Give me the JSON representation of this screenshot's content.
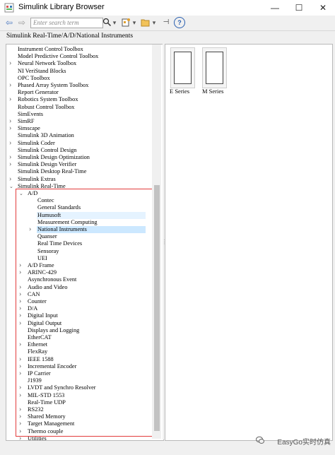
{
  "window": {
    "title": "Simulink Library Browser",
    "minimize_glyph": "—",
    "maximize_glyph": "☐",
    "close_glyph": "✕"
  },
  "toolbar": {
    "search_placeholder": "Enter search term",
    "back_glyph": "⇦",
    "forward_glyph": "⇨",
    "dropdown_glyph": "▾",
    "pin_glyph": "⊣",
    "help_glyph": "?"
  },
  "path": "Simulink Real-Time/A/D/National Instruments",
  "tree": [
    {
      "label": "Instrument Control Toolbox",
      "indent": 0,
      "arrow": ""
    },
    {
      "label": "Model Predictive Control Toolbox",
      "indent": 0,
      "arrow": ""
    },
    {
      "label": "Neural Network Toolbox",
      "indent": 0,
      "arrow": ">"
    },
    {
      "label": "NI VeriStand Blocks",
      "indent": 0,
      "arrow": ""
    },
    {
      "label": "OPC Toolbox",
      "indent": 0,
      "arrow": ""
    },
    {
      "label": "Phased Array System Toolbox",
      "indent": 0,
      "arrow": ">"
    },
    {
      "label": "Report Generator",
      "indent": 0,
      "arrow": ""
    },
    {
      "label": "Robotics System Toolbox",
      "indent": 0,
      "arrow": ">"
    },
    {
      "label": "Robust Control Toolbox",
      "indent": 0,
      "arrow": ""
    },
    {
      "label": "SimEvents",
      "indent": 0,
      "arrow": ""
    },
    {
      "label": "SimRF",
      "indent": 0,
      "arrow": ">"
    },
    {
      "label": "Simscape",
      "indent": 0,
      "arrow": ">"
    },
    {
      "label": "Simulink 3D Animation",
      "indent": 0,
      "arrow": ""
    },
    {
      "label": "Simulink Coder",
      "indent": 0,
      "arrow": ">"
    },
    {
      "label": "Simulink Control Design",
      "indent": 0,
      "arrow": ""
    },
    {
      "label": "Simulink Design Optimization",
      "indent": 0,
      "arrow": ">"
    },
    {
      "label": "Simulink Design Verifier",
      "indent": 0,
      "arrow": ">"
    },
    {
      "label": "Simulink Desktop Real-Time",
      "indent": 0,
      "arrow": ""
    },
    {
      "label": "Simulink Extras",
      "indent": 0,
      "arrow": ">"
    },
    {
      "label": "Simulink Real-Time",
      "indent": 0,
      "arrow": "v"
    },
    {
      "label": "A/D",
      "indent": 1,
      "arrow": "v"
    },
    {
      "label": "Contec",
      "indent": 2,
      "arrow": ""
    },
    {
      "label": "General Standards",
      "indent": 2,
      "arrow": ""
    },
    {
      "label": "Humusoft",
      "indent": 2,
      "arrow": "",
      "state": "hover"
    },
    {
      "label": "Measurement Computing",
      "indent": 2,
      "arrow": ""
    },
    {
      "label": "National Instruments",
      "indent": 2,
      "arrow": ">",
      "state": "selected"
    },
    {
      "label": "Quanser",
      "indent": 2,
      "arrow": ""
    },
    {
      "label": "Real Time Devices",
      "indent": 2,
      "arrow": ""
    },
    {
      "label": "Sensoray",
      "indent": 2,
      "arrow": ""
    },
    {
      "label": "UEI",
      "indent": 2,
      "arrow": ""
    },
    {
      "label": "A/D Frame",
      "indent": 1,
      "arrow": ">"
    },
    {
      "label": "ARINC-429",
      "indent": 1,
      "arrow": ">"
    },
    {
      "label": "Asynchronous Event",
      "indent": 1,
      "arrow": ""
    },
    {
      "label": "Audio and Video",
      "indent": 1,
      "arrow": ">"
    },
    {
      "label": "CAN",
      "indent": 1,
      "arrow": ">"
    },
    {
      "label": "Counter",
      "indent": 1,
      "arrow": ">"
    },
    {
      "label": "D/A",
      "indent": 1,
      "arrow": ">"
    },
    {
      "label": "Digital Input",
      "indent": 1,
      "arrow": ">"
    },
    {
      "label": "Digital Output",
      "indent": 1,
      "arrow": ">"
    },
    {
      "label": "Displays and Logging",
      "indent": 1,
      "arrow": ""
    },
    {
      "label": "EtherCAT",
      "indent": 1,
      "arrow": ""
    },
    {
      "label": "Ethernet",
      "indent": 1,
      "arrow": ">"
    },
    {
      "label": "FlexRay",
      "indent": 1,
      "arrow": ""
    },
    {
      "label": "IEEE 1588",
      "indent": 1,
      "arrow": ">"
    },
    {
      "label": "Incremental Encoder",
      "indent": 1,
      "arrow": ">"
    },
    {
      "label": "IP Carrier",
      "indent": 1,
      "arrow": ">"
    },
    {
      "label": "J1939",
      "indent": 1,
      "arrow": ""
    },
    {
      "label": "LVDT and Synchro Resolver",
      "indent": 1,
      "arrow": ">"
    },
    {
      "label": "MIL-STD 1553",
      "indent": 1,
      "arrow": ">"
    },
    {
      "label": "Real-Time UDP",
      "indent": 1,
      "arrow": ""
    },
    {
      "label": "RS232",
      "indent": 1,
      "arrow": ">"
    },
    {
      "label": "Shared Memory",
      "indent": 1,
      "arrow": ">"
    },
    {
      "label": "Target Management",
      "indent": 1,
      "arrow": ">"
    },
    {
      "label": "Thermo couple",
      "indent": 1,
      "arrow": ">"
    },
    {
      "label": "Utilities",
      "indent": 1,
      "arrow": ">"
    }
  ],
  "blocks": [
    {
      "label": "E Series"
    },
    {
      "label": "M Series"
    }
  ],
  "watermark": "EasyGo实时仿真",
  "colors": {
    "selection": "#cce8ff",
    "hover": "#e5f3ff",
    "highlight_box": "#e23c3c"
  }
}
